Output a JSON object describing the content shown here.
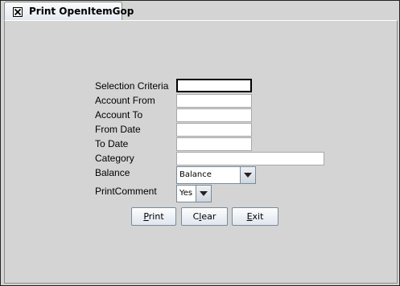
{
  "tab": {
    "title": "Print OpenItemGop",
    "close_icon": "close-box-icon"
  },
  "form": {
    "selection_criteria": {
      "label": "Selection Criteria",
      "value": ""
    },
    "account_from": {
      "label": "Account From",
      "value": ""
    },
    "account_to": {
      "label": "Account To",
      "value": ""
    },
    "from_date": {
      "label": "From Date",
      "value": ""
    },
    "to_date": {
      "label": "To Date",
      "value": ""
    },
    "category": {
      "label": "Category",
      "value": ""
    },
    "balance": {
      "label": "Balance",
      "selected": "Balance"
    },
    "print_comment": {
      "label": "PrintComment",
      "selected": "Yes"
    }
  },
  "buttons": {
    "print": {
      "mnemonic": "P",
      "rest": "rint"
    },
    "clear": {
      "pre": "C",
      "mnemonic": "l",
      "rest": "ear"
    },
    "exit": {
      "mnemonic": "E",
      "rest": "xit"
    }
  }
}
